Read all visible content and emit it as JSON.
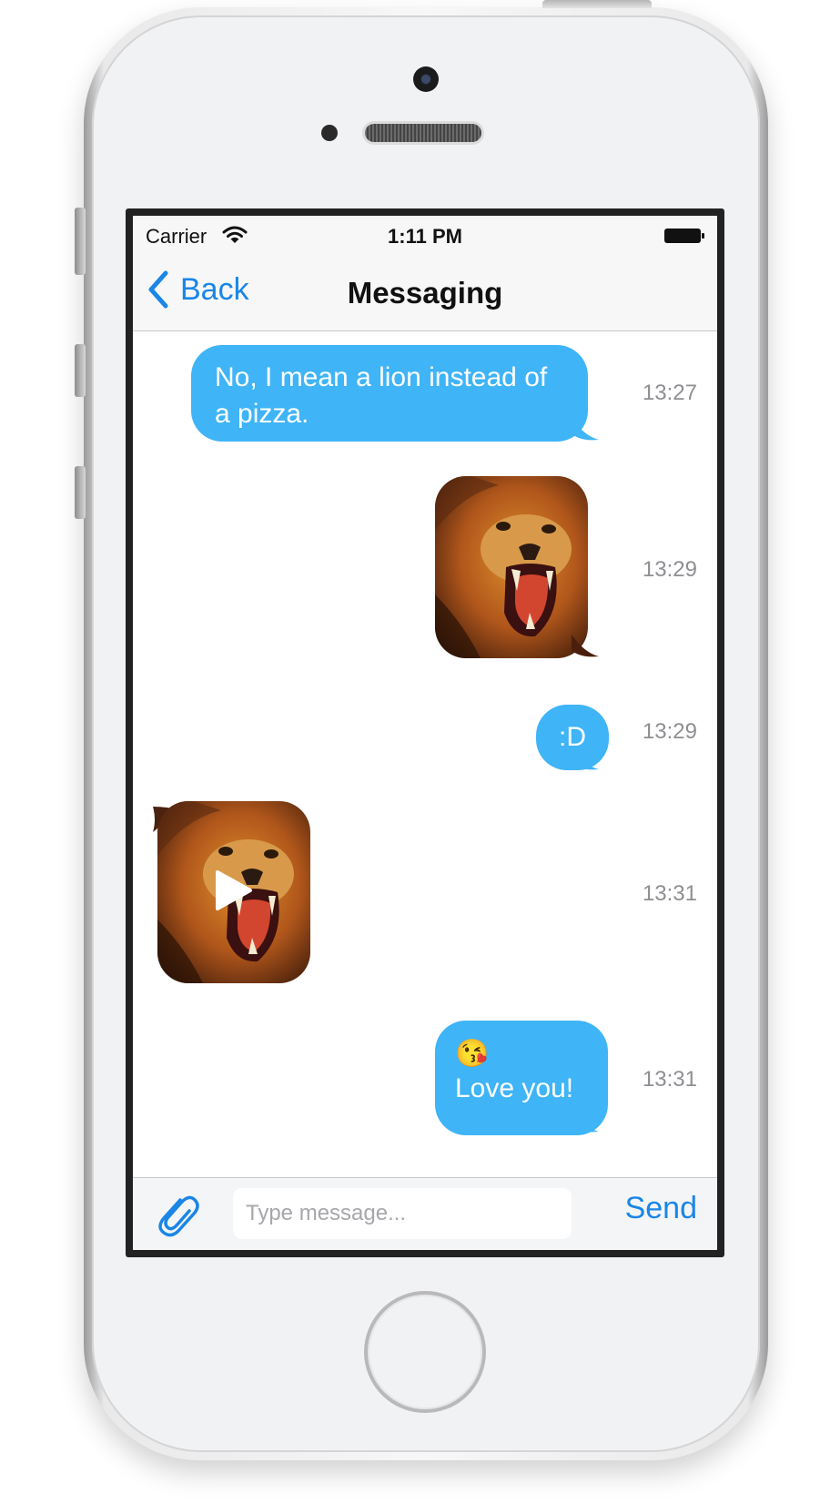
{
  "status_bar": {
    "carrier": "Carrier",
    "time": "1:11 PM"
  },
  "nav": {
    "back_label": "Back",
    "title": "Messaging"
  },
  "messages": [
    {
      "type": "text",
      "direction": "outgoing",
      "text": "No, I mean a lion instead of a pizza.",
      "time": "13:27"
    },
    {
      "type": "image",
      "direction": "outgoing",
      "media": "roaring-lion-photo",
      "time": "13:29"
    },
    {
      "type": "text",
      "direction": "outgoing",
      "text": ":D",
      "time": "13:29"
    },
    {
      "type": "video",
      "direction": "incoming",
      "media": "roaring-lion-video",
      "time": "13:31"
    },
    {
      "type": "text",
      "direction": "outgoing",
      "emoji": "😘",
      "text": "Love you!",
      "time": "13:31"
    }
  ],
  "composer": {
    "placeholder": "Type message...",
    "send_label": "Send",
    "attach_icon": "paperclip-icon"
  },
  "colors": {
    "bubble": "#3fb4f7",
    "accent": "#1a86e6",
    "timestamp": "#8e8e93"
  }
}
